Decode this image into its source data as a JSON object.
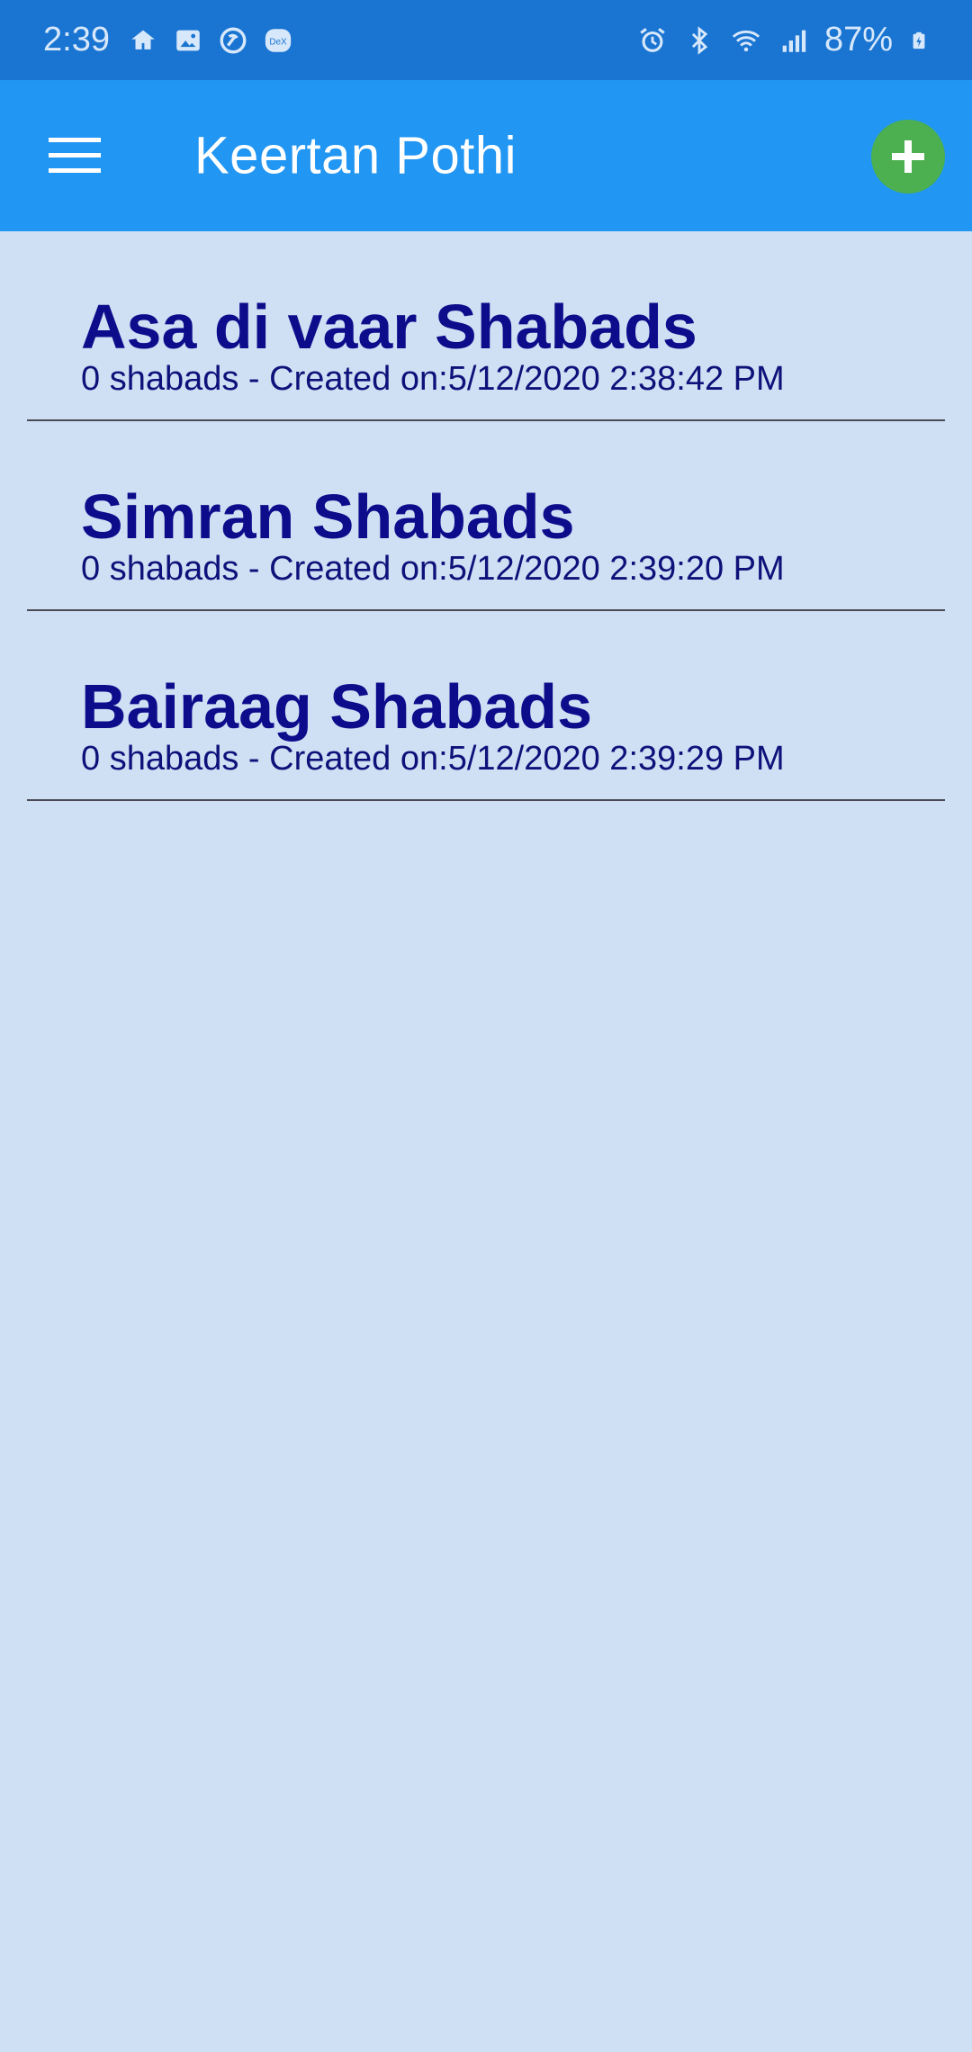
{
  "status_bar": {
    "time": "2:39",
    "battery_percent": "87%",
    "left_icons": [
      "home-icon",
      "image-icon",
      "sync-icon",
      "dex-icon"
    ],
    "right_icons": [
      "alarm-icon",
      "bluetooth-icon",
      "wifi-icon",
      "signal-icon",
      "battery-charging-icon"
    ],
    "dex_label": "DeX"
  },
  "app_bar": {
    "title": "Keertan Pothi",
    "menu_icon": "hamburger-menu-icon",
    "add_icon": "plus-icon",
    "colors": {
      "bar": "#2196f3",
      "add_button": "#4caf50"
    }
  },
  "pothis": [
    {
      "title": "Asa di vaar Shabads",
      "subtitle": "0 shabads - Created on:5/12/2020 2:38:42 PM"
    },
    {
      "title": "Simran Shabads",
      "subtitle": "0 shabads - Created on:5/12/2020 2:39:20 PM"
    },
    {
      "title": "Bairaag Shabads",
      "subtitle": "0 shabads - Created on:5/12/2020 2:39:29 PM"
    }
  ],
  "colors": {
    "background": "#cfe0f4",
    "title_text": "#0d0d8c",
    "status_bar": "#1a75d2"
  }
}
